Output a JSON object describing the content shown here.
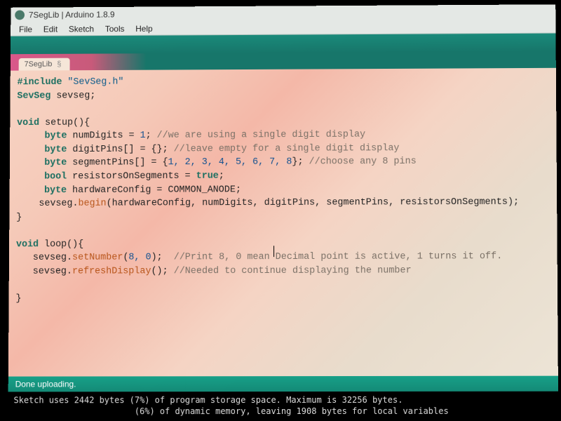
{
  "window": {
    "title": "7SegLib | Arduino 1.8.9"
  },
  "menu": {
    "file": "File",
    "edit": "Edit",
    "sketch": "Sketch",
    "tools": "Tools",
    "help": "Help"
  },
  "tab": {
    "name": "7SegLib"
  },
  "code": {
    "l1a": "#include",
    "l1b": "\"SevSeg.h\"",
    "l2a": "SevSeg",
    "l2b": " sevseg;",
    "l4a": "void",
    "l4b": " setup(){",
    "l5a": "byte",
    "l5b": " numDigits = ",
    "l5n": "1",
    "l5c": "; ",
    "l5d": "//we are using a single digit display",
    "l6a": "byte",
    "l6b": " digitPins[] = {}; ",
    "l6c": "//leave empty for a single digit display",
    "l7a": "byte",
    "l7b": " segmentPins[] = {",
    "l7n": "1, 2, 3, 4, 5, 6, 7, 8",
    "l7c": "}; ",
    "l7d": "//choose any 8 pins",
    "l8a": "bool",
    "l8b": " resistorsOnSegments = ",
    "l8c": "true",
    "l8d": ";",
    "l9a": "byte",
    "l9b": " hardwareConfig = COMMON_ANODE;",
    "l10a": "    sevseg.",
    "l10b": "begin",
    "l10c": "(hardwareConfig, numDigits, digitPins, segmentPins, resistorsOnSegments);",
    "l11": "}",
    "l13a": "void",
    "l13b": " loop(){",
    "l14a": "   sevseg.",
    "l14b": "setNumber",
    "l14c": "(",
    "l14n": "8, 0",
    "l14d": ");  ",
    "l14e": "//Print 8, 0 mean Decimal point is active, 1 turns it off.",
    "l15a": "   sevseg.",
    "l15b": "refreshDisplay",
    "l15c": "(); ",
    "l15d": "//Needed to continue displaying the number",
    "l17": "}"
  },
  "status": {
    "text": "Done uploading."
  },
  "console": {
    "line1": "Sketch uses 2442 bytes (7%) of program storage space. Maximum is 32256 bytes.",
    "line2": "                        (6%) of dynamic memory, leaving 1908 bytes for local variables"
  }
}
